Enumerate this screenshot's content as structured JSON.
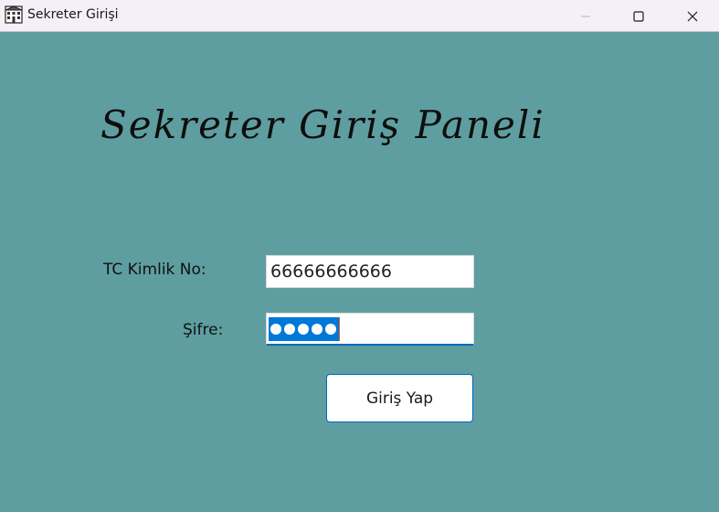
{
  "window": {
    "title": "Sekreter Girişi",
    "icon": "building-icon",
    "controls": [
      "minimize-icon",
      "maximize-icon",
      "close-icon"
    ]
  },
  "panel": {
    "heading": "Sekreter Giriş Paneli",
    "tc_label": "TC Kimlik No:",
    "tc_value": "66666666666",
    "password_label": "Şifre:",
    "password_masked_count": 5,
    "login_button": "Giriş Yap"
  },
  "colors": {
    "background": "#5f9ea0",
    "selection": "#0078d7",
    "accent": "#0067c0"
  }
}
